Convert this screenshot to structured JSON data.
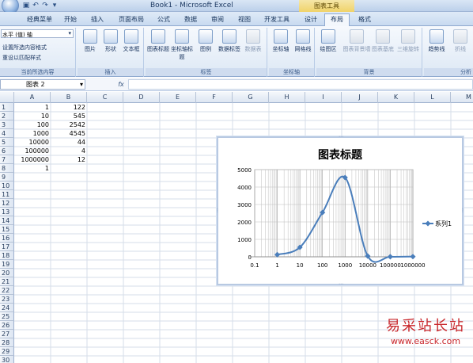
{
  "window": {
    "title": "Book1 - Microsoft Excel",
    "tools_label": "图表工具"
  },
  "tabs": [
    "经典菜单",
    "开始",
    "插入",
    "页面布局",
    "公式",
    "数据",
    "审阅",
    "视图",
    "开发工具",
    "设计",
    "布局",
    "格式"
  ],
  "active_tab": "布局",
  "ribbon": {
    "selection_dropdown": "水平 (值) 轴",
    "format_selection": "设置所选内容格式",
    "reset_style": "重设以匹配样式",
    "current_selection_label": "当前所选内容",
    "insert_group_label": "插入",
    "labels_group_label": "标签",
    "axes_group_label": "坐标轴",
    "background_group_label": "背景",
    "analysis_group_label": "分析",
    "buttons": {
      "picture": "图片",
      "shapes": "形状",
      "textbox": "文本框",
      "chart_title": "图表标题",
      "axis_title": "坐标轴标题",
      "legend": "图例",
      "data_labels": "数据标签",
      "data_table": "数据表",
      "axes": "坐标轴",
      "gridlines": "网格线",
      "plot_area": "绘图区",
      "chart_wall": "图表背景墙",
      "chart_floor": "图表基底",
      "rotation_3d": "三维旋转",
      "trendline": "趋势线",
      "lines": "折线"
    }
  },
  "formula_bar": {
    "name_box": "图表 2",
    "fx": "fx",
    "content": ""
  },
  "sheet": {
    "columns": [
      "A",
      "B",
      "C",
      "D",
      "E",
      "F",
      "G",
      "H",
      "I",
      "J",
      "K",
      "L",
      "M"
    ],
    "rows": [
      "1",
      "2",
      "3",
      "4",
      "5",
      "6",
      "7",
      "8",
      "9",
      "10",
      "11",
      "12",
      "13",
      "14",
      "15",
      "16",
      "17",
      "18",
      "19",
      "20",
      "21",
      "22",
      "23",
      "24",
      "25",
      "26",
      "27",
      "28",
      "29",
      "30"
    ],
    "col_a": [
      "1",
      "10",
      "100",
      "1000",
      "10000",
      "100000",
      "1000000",
      "1"
    ],
    "col_b": [
      "122",
      "545",
      "2542",
      "4545",
      "44",
      "4",
      "12"
    ]
  },
  "chart_data": {
    "type": "scatter",
    "title": "图表标题",
    "x_scale": "log",
    "x_ticks": [
      "0.1",
      "1",
      "10",
      "100",
      "1000",
      "10000",
      "100000",
      "1000000"
    ],
    "y_ticks": [
      "0",
      "1000",
      "2000",
      "3000",
      "4000",
      "5000"
    ],
    "ylim": [
      0,
      5000
    ],
    "series": [
      {
        "name": "系列1",
        "x": [
          1,
          10,
          100,
          1000,
          10000,
          100000,
          1000000
        ],
        "y": [
          122,
          545,
          2542,
          4545,
          44,
          4,
          12
        ],
        "color": "#4a7ebb"
      }
    ],
    "legend_position": "right",
    "grid": true
  },
  "watermark": {
    "text_cn": "易采站长站",
    "url": "www.easck.com"
  }
}
